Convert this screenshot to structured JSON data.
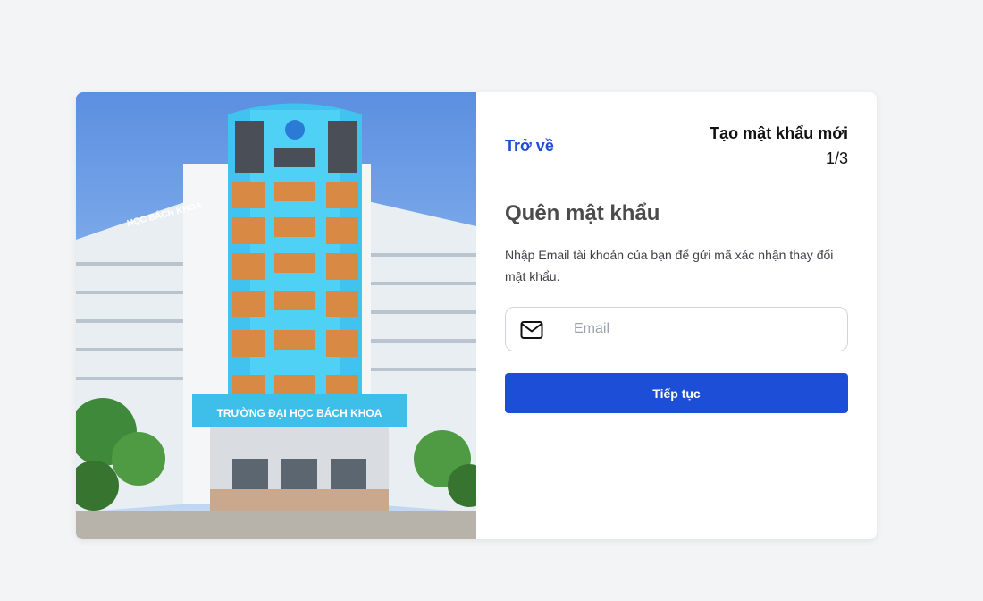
{
  "photo": {
    "alt": "Trường Đại học Bách Khoa building",
    "sign_text": "TRƯỜNG ĐẠI HỌC BÁCH KHOA",
    "side_text": "HỌC BÁCH KHOA"
  },
  "form": {
    "back_label": "Trở về",
    "step_title": "Tạo mật khẩu mới",
    "step_count": "1/3",
    "heading": "Quên mật khẩu",
    "description": "Nhập Email tài khoản của bạn để gửi mã xác nhận thay đổi mật khẩu.",
    "email_placeholder": "Email",
    "email_value": "",
    "email_icon": "mail-icon",
    "submit_label": "Tiếp tục"
  },
  "colors": {
    "page_background": "#f3f4f6",
    "accent": "#1d4ed8",
    "card_background": "#ffffff"
  }
}
